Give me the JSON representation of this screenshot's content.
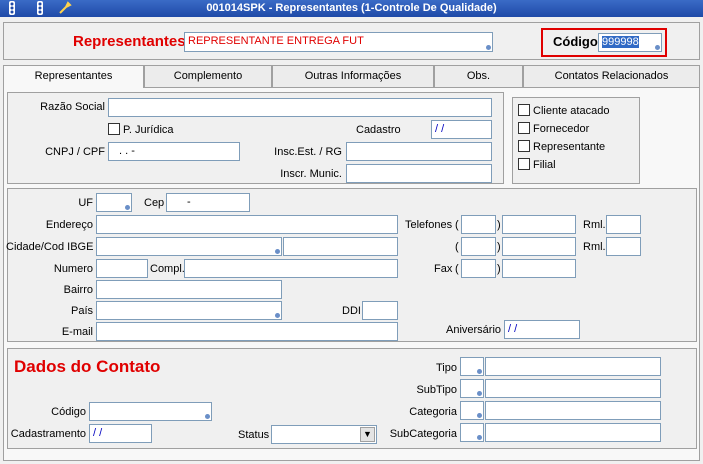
{
  "window": {
    "title": "001014SPK - Representantes (1-Controle De Qualidade)"
  },
  "toolbar": {
    "icons": [
      "traffic-light-icon",
      "tool-icon"
    ]
  },
  "header": {
    "label": "Representantes",
    "name_value": "REPRESENTANTE ENTREGA FUT",
    "codigo_label": "Código",
    "codigo_value": "999998"
  },
  "tabs": [
    {
      "label": "Representantes"
    },
    {
      "label": "Complemento"
    },
    {
      "label": "Outras Informações"
    },
    {
      "label": "Obs."
    },
    {
      "label": "Contatos Relacionados"
    }
  ],
  "section1": {
    "razao_social_label": "Razão Social",
    "pj_label": "P. Jurídica",
    "cadastro_label": "Cadastro",
    "cadastro_value": "/ /",
    "cnpj_label": "CNPJ / CPF",
    "cnpj_value": ". . -",
    "insc_est_label": "Insc.Est. / RG",
    "insc_munic_label": "Inscr. Munic.",
    "checkboxes": [
      "Cliente atacado",
      "Fornecedor",
      "Representante",
      "Filial"
    ]
  },
  "section2": {
    "uf_label": "UF",
    "cep_label": "Cep",
    "cep_value": "-",
    "endereco_label": "Endereço",
    "cidade_label": "Cidade/Cod IBGE",
    "numero_label": "Numero",
    "compl_label": "Compl.",
    "bairro_label": "Bairro",
    "pais_label": "País",
    "ddi_label": "DDI",
    "email_label": "E-mail",
    "telefones_label": "Telefones",
    "rml_label": "Rml.",
    "fax_label": "Fax",
    "aniversario_label": "Aniversário",
    "aniversario_value": "/ /",
    "paren_open": "(",
    "paren_close": ")"
  },
  "section3": {
    "title": "Dados do Contato",
    "codigo_label": "Código",
    "cadastramento_label": "Cadastramento",
    "cadastramento_value": "/ /",
    "status_label": "Status",
    "tipo_label": "Tipo",
    "subtipo_label": "SubTipo",
    "categoria_label": "Categoria",
    "subcategoria_label": "SubCategoria"
  }
}
